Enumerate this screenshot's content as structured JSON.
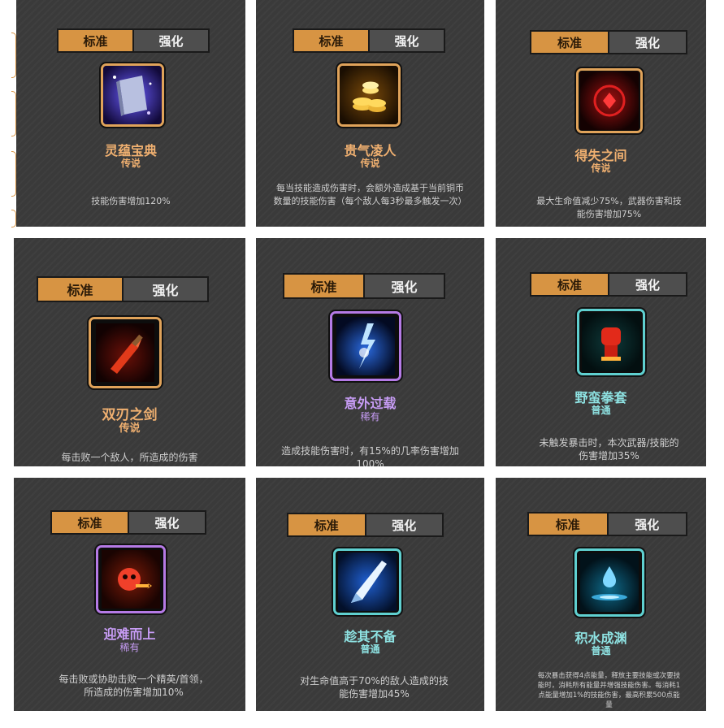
{
  "tabs": {
    "standard": "标准",
    "enhanced": "强化"
  },
  "cards": [
    {
      "icon": "spell-book-icon",
      "name": "灵蕴宝典",
      "rarity": "传说",
      "desc": "技能伤害增加120%"
    },
    {
      "icon": "gold-coins-icon",
      "name": "贵气凌人",
      "rarity": "传说",
      "desc": "每当技能造成伤害时，会额外造成基于当前铜币数量的技能伤害（每个敌人每3秒最多触发一次）"
    },
    {
      "icon": "red-gem-icon",
      "name": "得失之间",
      "rarity": "传说",
      "desc": "最大生命值减少75%，武器伤害和技能伤害增加75%"
    },
    {
      "icon": "twin-blade-sword-icon",
      "name": "双刃之剑",
      "rarity": "传说",
      "desc": "每击败一个敌人，所造成的伤害"
    },
    {
      "icon": "lightning-overload-icon",
      "name": "意外过载",
      "rarity": "稀有",
      "desc": "造成技能伤害时，有15%的几率伤害增加100%"
    },
    {
      "icon": "fist-gauntlet-icon",
      "name": "野蛮拳套",
      "rarity": "普通",
      "desc": "未触发暴击时，本次武器/技能的伤害增加35%"
    },
    {
      "icon": "rising-skull-icon",
      "name": "迎难而上",
      "rarity": "稀有",
      "desc": "每击败或协助击败一个精英/首领，所造成的伤害增加10%"
    },
    {
      "icon": "surprise-blade-icon",
      "name": "趁其不备",
      "rarity": "普通",
      "desc": "对生命值高于70%的敌人造成的技能伤害增加45%"
    },
    {
      "icon": "water-drop-icon",
      "name": "积水成渊",
      "rarity": "普通",
      "desc": "每次暴击获得4点能量，释放主要技能或次要技能时，消耗所有能量并增强技能伤害。每消耗1点能量增加1%的技能伤害，最高积累500点能量"
    }
  ]
}
